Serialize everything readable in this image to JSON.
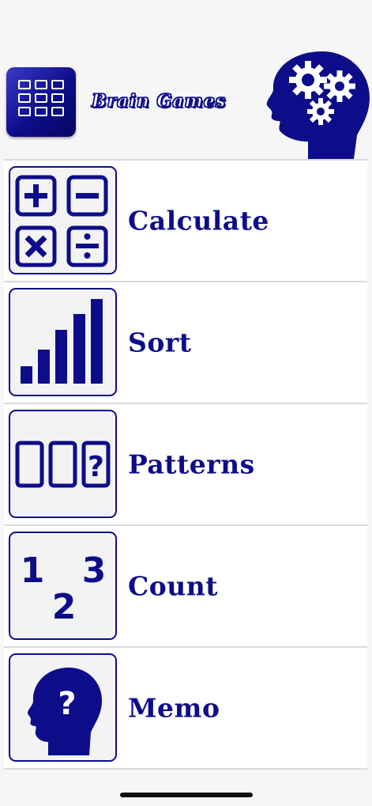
{
  "app": {
    "title": "Brain Games",
    "accent_color": "#0d0d8a"
  },
  "header": {
    "app_icon": "grid-icon",
    "logo_icon": "head-gears-icon"
  },
  "menu": [
    {
      "label": "Calculate",
      "icon": "calculator-operators-icon"
    },
    {
      "label": "Sort",
      "icon": "ascending-bars-icon"
    },
    {
      "label": "Patterns",
      "icon": "pattern-cards-icon"
    },
    {
      "label": "Count",
      "icon": "numbers-123-icon"
    },
    {
      "label": "Memo",
      "icon": "head-question-icon"
    }
  ]
}
